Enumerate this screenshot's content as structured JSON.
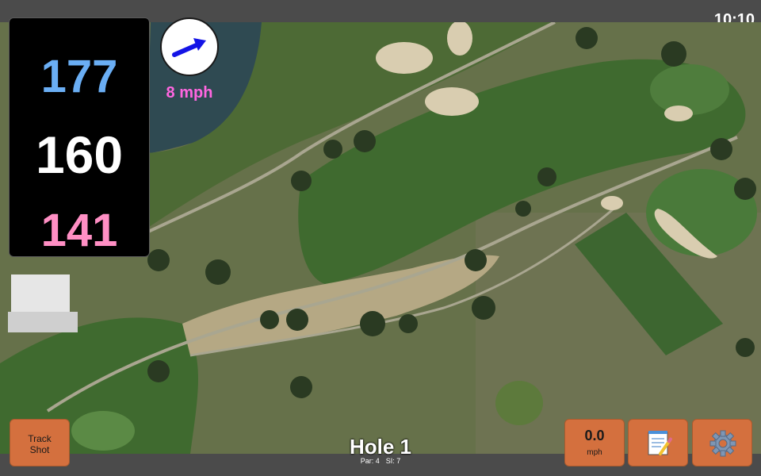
{
  "status_bar": {
    "time": "10:10"
  },
  "distances": {
    "back": "177",
    "middle": "160",
    "front": "141"
  },
  "wind": {
    "speed": "8 mph",
    "direction_icon": "wind-arrow-icon"
  },
  "hole": {
    "title": "Hole 1",
    "par": "Par: 4",
    "stroke_index": "SI: 7"
  },
  "buttons": {
    "track_shot_line1": "Track",
    "track_shot_line2": "Shot",
    "speed_value": "0.0",
    "speed_unit": "mph",
    "notes_icon": "notepad-icon",
    "settings_icon": "gear-icon"
  },
  "colors": {
    "back_distance": "#6aaef4",
    "middle_distance": "#ffffff",
    "front_distance": "#ff8fc4",
    "wind_text": "#ff66e0",
    "button": "#d4703e",
    "arrow": "#1414e6"
  }
}
